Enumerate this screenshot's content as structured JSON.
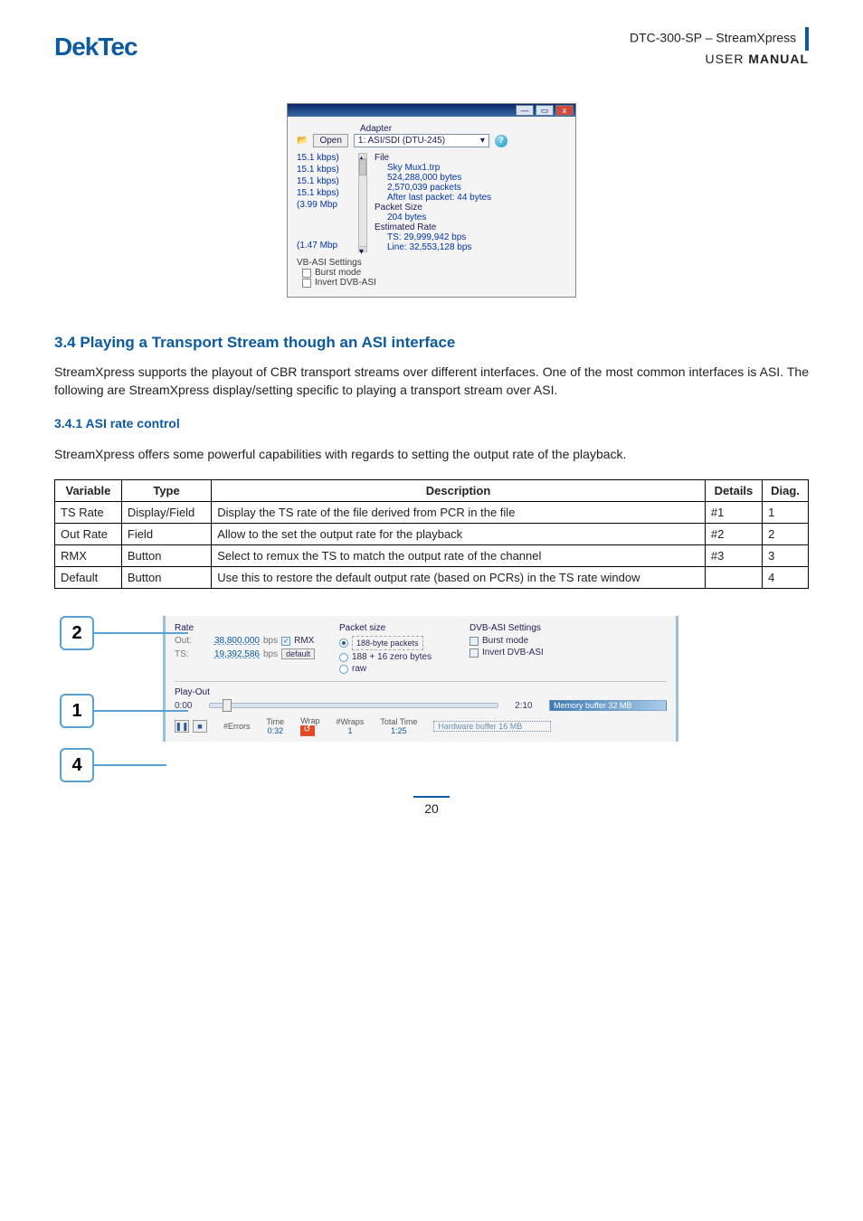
{
  "doc": {
    "header_line1": "DTC-300-SP – StreamXpress",
    "header_line2_a": "USER ",
    "header_line2_b": "MANUAL",
    "logo": "DekTec",
    "page_number": "20"
  },
  "win1": {
    "adapter_label": "Adapter",
    "open_label": "Open",
    "adapter_value": "1: ASI/SDI (DTU-245)",
    "left_list": [
      "15.1 kbps)",
      "15.1 kbps)",
      "15.1 kbps)",
      "15.1 kbps)",
      "(3.99 Mbp"
    ],
    "left_bottom": "(1.47 Mbp",
    "file_label": "File",
    "file_name": "Sky Mux1.trp",
    "file_bytes": "524,288,000 bytes",
    "file_packets": "2,570,039 packets",
    "file_after": "After last packet: 44 bytes",
    "packet_size_label": "Packet Size",
    "packet_size_value": "204 bytes",
    "est_rate_label": "Estimated Rate",
    "est_rate_ts": "TS: 29,999,942 bps",
    "est_rate_line": "Line: 32,553,128 bps",
    "vb_asi_label": "VB-ASI Settings",
    "burst_label": "Burst mode",
    "invert_label": "Invert DVB-ASI"
  },
  "section": {
    "h2": "3.4 Playing a Transport Stream though an ASI interface",
    "p1": "StreamXpress supports the playout of CBR transport streams over different interfaces. One of the most common interfaces is ASI. The following are StreamXpress display/setting specific to playing a transport stream over ASI.",
    "h3": "3.4.1 ASI rate control",
    "p2": "StreamXpress offers some powerful capabilities with regards to setting the output rate of the playback."
  },
  "table": {
    "headers": [
      "Variable",
      "Type",
      "Description",
      "Details",
      "Diag."
    ],
    "rows": [
      {
        "v": "TS Rate",
        "t": "Display/Field",
        "d": "Display the TS rate of the file derived from PCR in the file",
        "det": "#1",
        "diag": "1"
      },
      {
        "v": "Out Rate",
        "t": "Field",
        "d": "Allow to the set the output rate for the playback",
        "det": "#2",
        "diag": "2"
      },
      {
        "v": "RMX",
        "t": "Button",
        "d": "Select to remux the TS to match the output rate of the channel",
        "det": "#3",
        "diag": "3"
      },
      {
        "v": "Default",
        "t": "Button",
        "d": "Use this to restore the default output rate (based on PCRs) in the TS rate window",
        "det": "",
        "diag": "4"
      }
    ]
  },
  "panel": {
    "rate_label": "Rate",
    "out_label": "Out:",
    "out_value": "38,800,000",
    "bps": "bps",
    "rmx": "RMX",
    "ts_label": "TS:",
    "ts_value": "19,392,586",
    "default": "default",
    "packet_size_label": "Packet size",
    "pkt_188": "188-byte packets",
    "pkt_204": "188 + 16 zero bytes",
    "pkt_raw": "raw",
    "dvbasi_label": "DVB-ASI Settings",
    "burst": "Burst mode",
    "invert": "Invert DVB-ASI",
    "playout_label": "Play-Out",
    "time_start": "0:00",
    "time_end": "2:10",
    "membuf": "Memory buffer 32 MB",
    "hwbuf": "Hardware buffer 16 MB",
    "cols": {
      "errors_h": "#Errors",
      "errors_v": "",
      "time_h": "Time",
      "time_v": "0:32",
      "wrap_h": "Wrap",
      "wraps_h": "#Wraps",
      "wraps_v": "1",
      "total_h": "Total Time",
      "total_v": "1:25"
    }
  },
  "callouts": {
    "c1": "1",
    "c2": "2",
    "c4": "4"
  }
}
